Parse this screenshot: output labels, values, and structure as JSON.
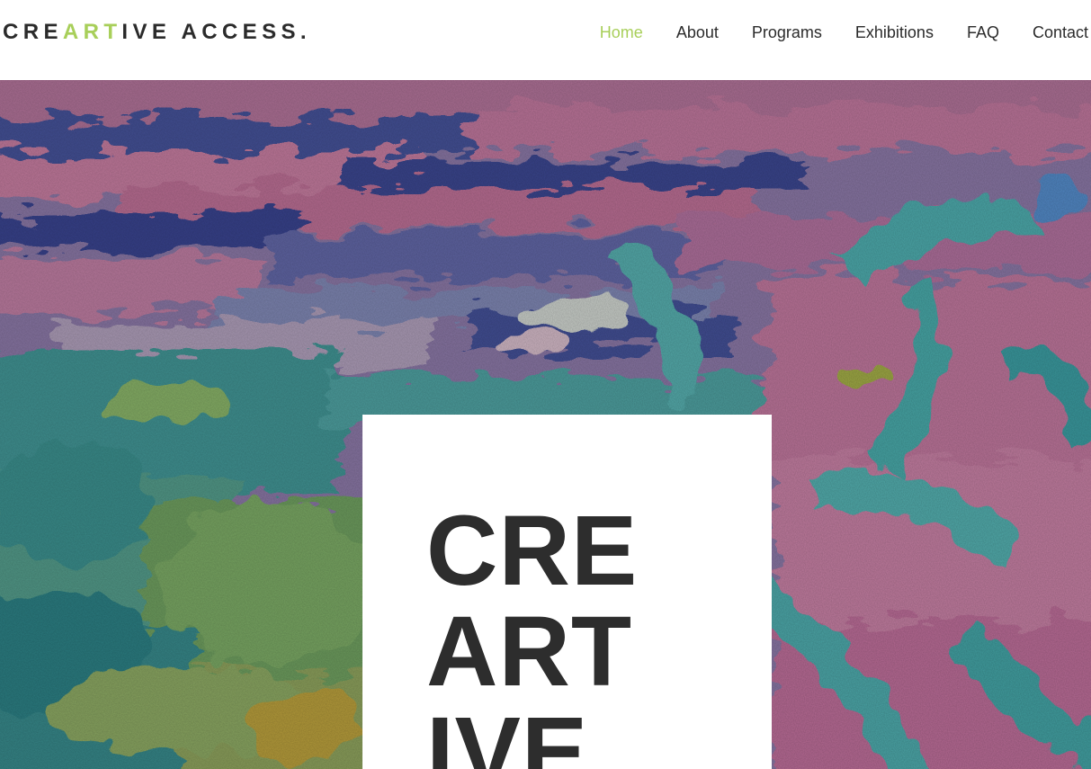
{
  "brand": {
    "logo_parts": [
      "CRE",
      "ART",
      "IVE ACCESS."
    ],
    "accent_color": "#a8cf5a"
  },
  "nav": {
    "items": [
      {
        "label": "Home",
        "active": true
      },
      {
        "label": "About",
        "active": false
      },
      {
        "label": "Programs",
        "active": false
      },
      {
        "label": "Exhibitions",
        "active": false
      },
      {
        "label": "FAQ",
        "active": false
      },
      {
        "label": "Contact",
        "active": false
      }
    ]
  },
  "hero": {
    "background": "abstract-painting",
    "title_lines": [
      "CRE",
      "ART",
      "IVE"
    ],
    "palette": {
      "pink": "#d77aa6",
      "blue": "#3d4a9a",
      "teal": "#4ab8b0",
      "green": "#6fb46a",
      "lavender": "#b89ac8"
    }
  }
}
